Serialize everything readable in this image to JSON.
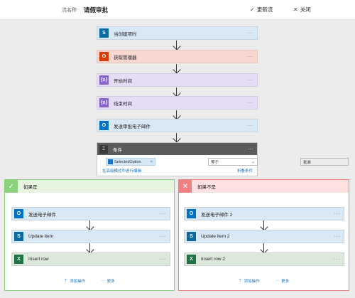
{
  "header": {
    "flow_name_label": "流名称",
    "flow_name": "请假审批",
    "update_label": "更新流",
    "close_label": "关闭"
  },
  "steps": [
    {
      "title": "当创建项时",
      "icon": "sharepoint-icon",
      "color": "#0b6a9f",
      "bg": "#d9e8f5"
    },
    {
      "title": "获取管理器",
      "icon": "office365-icon",
      "color": "#d83b01",
      "bg": "#f9d7d0"
    },
    {
      "title": "开始时间",
      "icon": "expression-icon",
      "color": "#8661c5",
      "bg": "#e5ddf6"
    },
    {
      "title": "结束时间",
      "icon": "expression-icon",
      "color": "#8661c5",
      "bg": "#e5ddf6"
    },
    {
      "title": "发送审批电子邮件",
      "icon": "outlook-icon",
      "color": "#0072c6",
      "bg": "#d9e8f5"
    }
  ],
  "condition": {
    "title": "条件",
    "token": "SelectedOption",
    "operator": "等于",
    "value": "批准",
    "edit_link": "在高级模式中进行编辑",
    "collapse_link": "折叠条件"
  },
  "branches": {
    "yes": {
      "title": "如果是",
      "color": "#8bd17c",
      "bg": "#e5f5e0",
      "steps": [
        {
          "title": "发送电子邮件",
          "icon": "outlook-icon",
          "color": "#0072c6",
          "bg": "#d9e8f5"
        },
        {
          "title": "Update item",
          "icon": "sharepoint-icon",
          "color": "#0b6a9f",
          "bg": "#d9e8f5"
        },
        {
          "title": "Insert row",
          "icon": "excel-icon",
          "color": "#217346",
          "bg": "#dde8dd"
        }
      ],
      "add_action": "添加操作",
      "more": "更多"
    },
    "no": {
      "title": "如果不是",
      "color": "#f08080",
      "bg": "#fde0e0",
      "steps": [
        {
          "title": "发送电子邮件 2",
          "icon": "outlook-icon",
          "color": "#0072c6",
          "bg": "#d9e8f5"
        },
        {
          "title": "Update item 2",
          "icon": "sharepoint-icon",
          "color": "#0b6a9f",
          "bg": "#d9e8f5"
        },
        {
          "title": "Insert row 2",
          "icon": "excel-icon",
          "color": "#217346",
          "bg": "#dde8dd"
        }
      ],
      "add_action": "添加操作",
      "more": "更多"
    }
  }
}
